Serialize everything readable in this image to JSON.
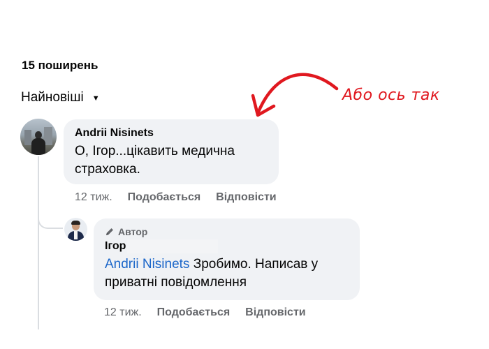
{
  "header": {
    "shares_label": "15 поширень",
    "sort_label": "Найновіші",
    "sort_chevron": "⌄"
  },
  "annotation": {
    "text": "Або ось так",
    "color": "#e0181f"
  },
  "comments": [
    {
      "author": "Andrii Nisinets",
      "text": "О, Ігор...цікавить медична страховка.",
      "time": "12 тиж.",
      "like_label": "Подобається",
      "reply_label": "Відповісти"
    },
    {
      "badge": "Автор",
      "author": "Ігор",
      "mention": "Andrii Nisinets",
      "text": " Зробимо. Написав у приватні повідомлення",
      "time": "12 тиж.",
      "like_label": "Подобається",
      "reply_label": "Відповісти"
    }
  ],
  "colors": {
    "bubble_bg": "#f0f2f5",
    "mention": "#1b66c9",
    "secondary_text": "#65676b"
  }
}
